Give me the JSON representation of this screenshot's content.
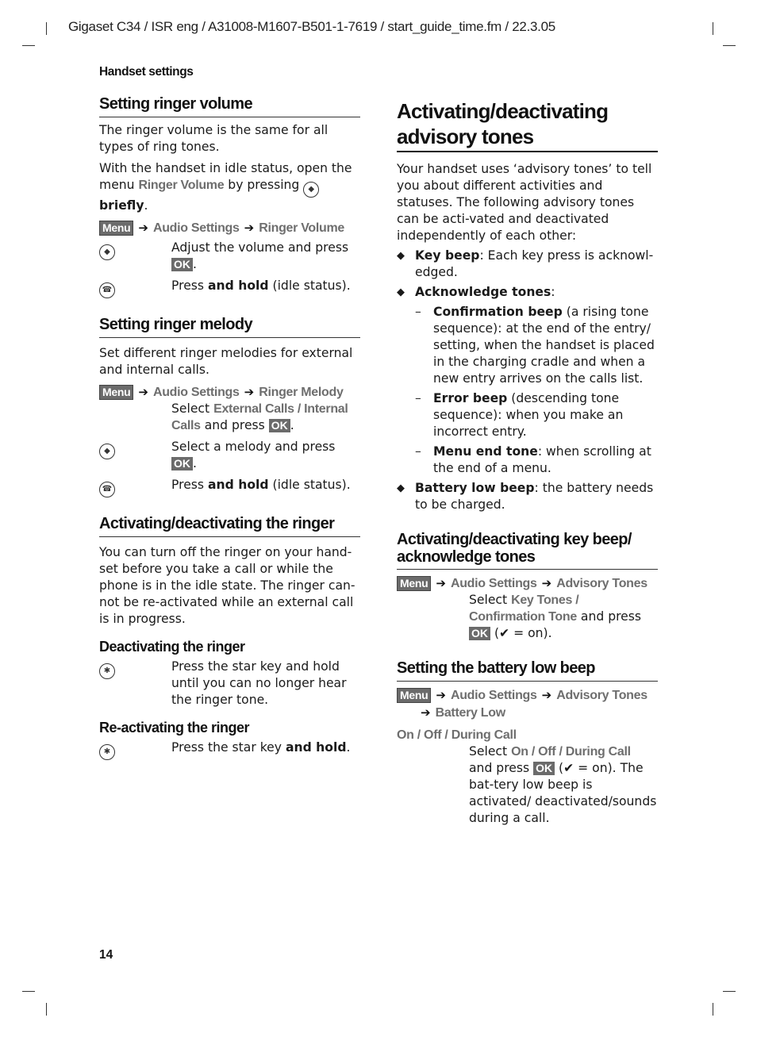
{
  "header": {
    "doc_line": "Gigaset C34 / ISR eng / A31008-M1607-B501-1-7619 / start_guide_time.fm / 22.3.05",
    "running_head": "Handset settings",
    "page_number": "14"
  },
  "keys": {
    "menu": "Menu",
    "ok": "OK",
    "arrow": "➔",
    "check": "✔"
  },
  "icons": {
    "control_key": "navigation-key-icon",
    "end_key": "end-call-key-icon",
    "star_key": "star-key-icon"
  },
  "left": {
    "ringer_volume": {
      "title": "Setting ringer volume",
      "p1": "The ringer volume is the same for all types of ring tones.",
      "p2_a": "With the handset in idle status, open the menu ",
      "p2_ui": "Ringer Volume",
      "p2_b": " by pressing ",
      "p2_c": "briefly",
      "p2_d": ".",
      "path": [
        "Audio Settings",
        "Ringer Volume"
      ],
      "step1_a": "Adjust the volume and press ",
      "step1_b": ".",
      "step2_a": "Press ",
      "step2_b": "and hold",
      "step2_c": " (idle status)."
    },
    "ringer_melody": {
      "title": "Setting ringer melody",
      "p1": "Set different ringer melodies for external and internal calls.",
      "path": [
        "Audio Settings",
        "Ringer Melody"
      ],
      "select_a": "Select ",
      "select_ui1": "External Calls",
      "select_sep": " / ",
      "select_ui2": "Internal Calls",
      "select_b": " and press ",
      "select_c": ".",
      "step1_a": "Select a melody and press ",
      "step1_b": ".",
      "step2_a": "Press ",
      "step2_b": "and hold",
      "step2_c": " (idle status)."
    },
    "ringer_onoff": {
      "title": "Activating/deactivating the ringer",
      "p1": "You can turn off the ringer on your hand-set before you take a call or while the phone is in the idle state. The ringer can-not be re-activated while an external call is in progress.",
      "deact_title": "Deactivating the ringer",
      "deact_text": "Press the star key and hold until you can no longer hear the ringer tone.",
      "react_title": "Re-activating the ringer",
      "react_a": "Press the star key ",
      "react_b": "and hold",
      "react_c": "."
    }
  },
  "right": {
    "advisory": {
      "title": "Activating/deactivating advisory tones",
      "intro": "Your handset uses ‘advisory tones’ to tell you about different activities and statuses. The following advisory tones can be acti-vated and deactivated independently of each other:",
      "key_beep_b": "Key beep",
      "key_beep_t": ": Each key press is acknowl-edged.",
      "ack_b": "Acknowledge tones",
      "ack_t": ":",
      "confirm_b": "Confirmation beep",
      "confirm_t": " (a rising tone sequence): at the end of the entry/ setting, when the handset is placed in the charging cradle and when a new entry arrives on the calls list.",
      "error_b": "Error beep",
      "error_t": " (descending tone sequence): when you make an incorrect entry.",
      "menuend_b": "Menu end tone",
      "menuend_t": ": when scrolling at the end of a menu.",
      "battery_b": "Battery low beep",
      "battery_t": ": the battery needs to be charged."
    },
    "key_beep": {
      "title": "Activating/deactivating key beep/ acknowledge tones",
      "path": [
        "Audio Settings",
        "Advisory Tones"
      ],
      "select_a": "Select ",
      "select_ui1": "Key Tones",
      "select_sep": " / ",
      "select_ui2": "Confirmation Tone",
      "select_b": " and press ",
      "select_c": " (",
      "select_d": " = on)."
    },
    "battery_low": {
      "title": "Setting the battery low beep",
      "path": [
        "Audio Settings",
        "Advisory Tones",
        "Battery Low"
      ],
      "options_line": "On / Off / During Call",
      "select_a": "Select ",
      "select_ui": "On / Off / During Call",
      "select_b": " and press ",
      "select_c": " (",
      "select_d": " = on). The bat-tery low beep is activated/ deactivated/sounds during a call."
    }
  }
}
